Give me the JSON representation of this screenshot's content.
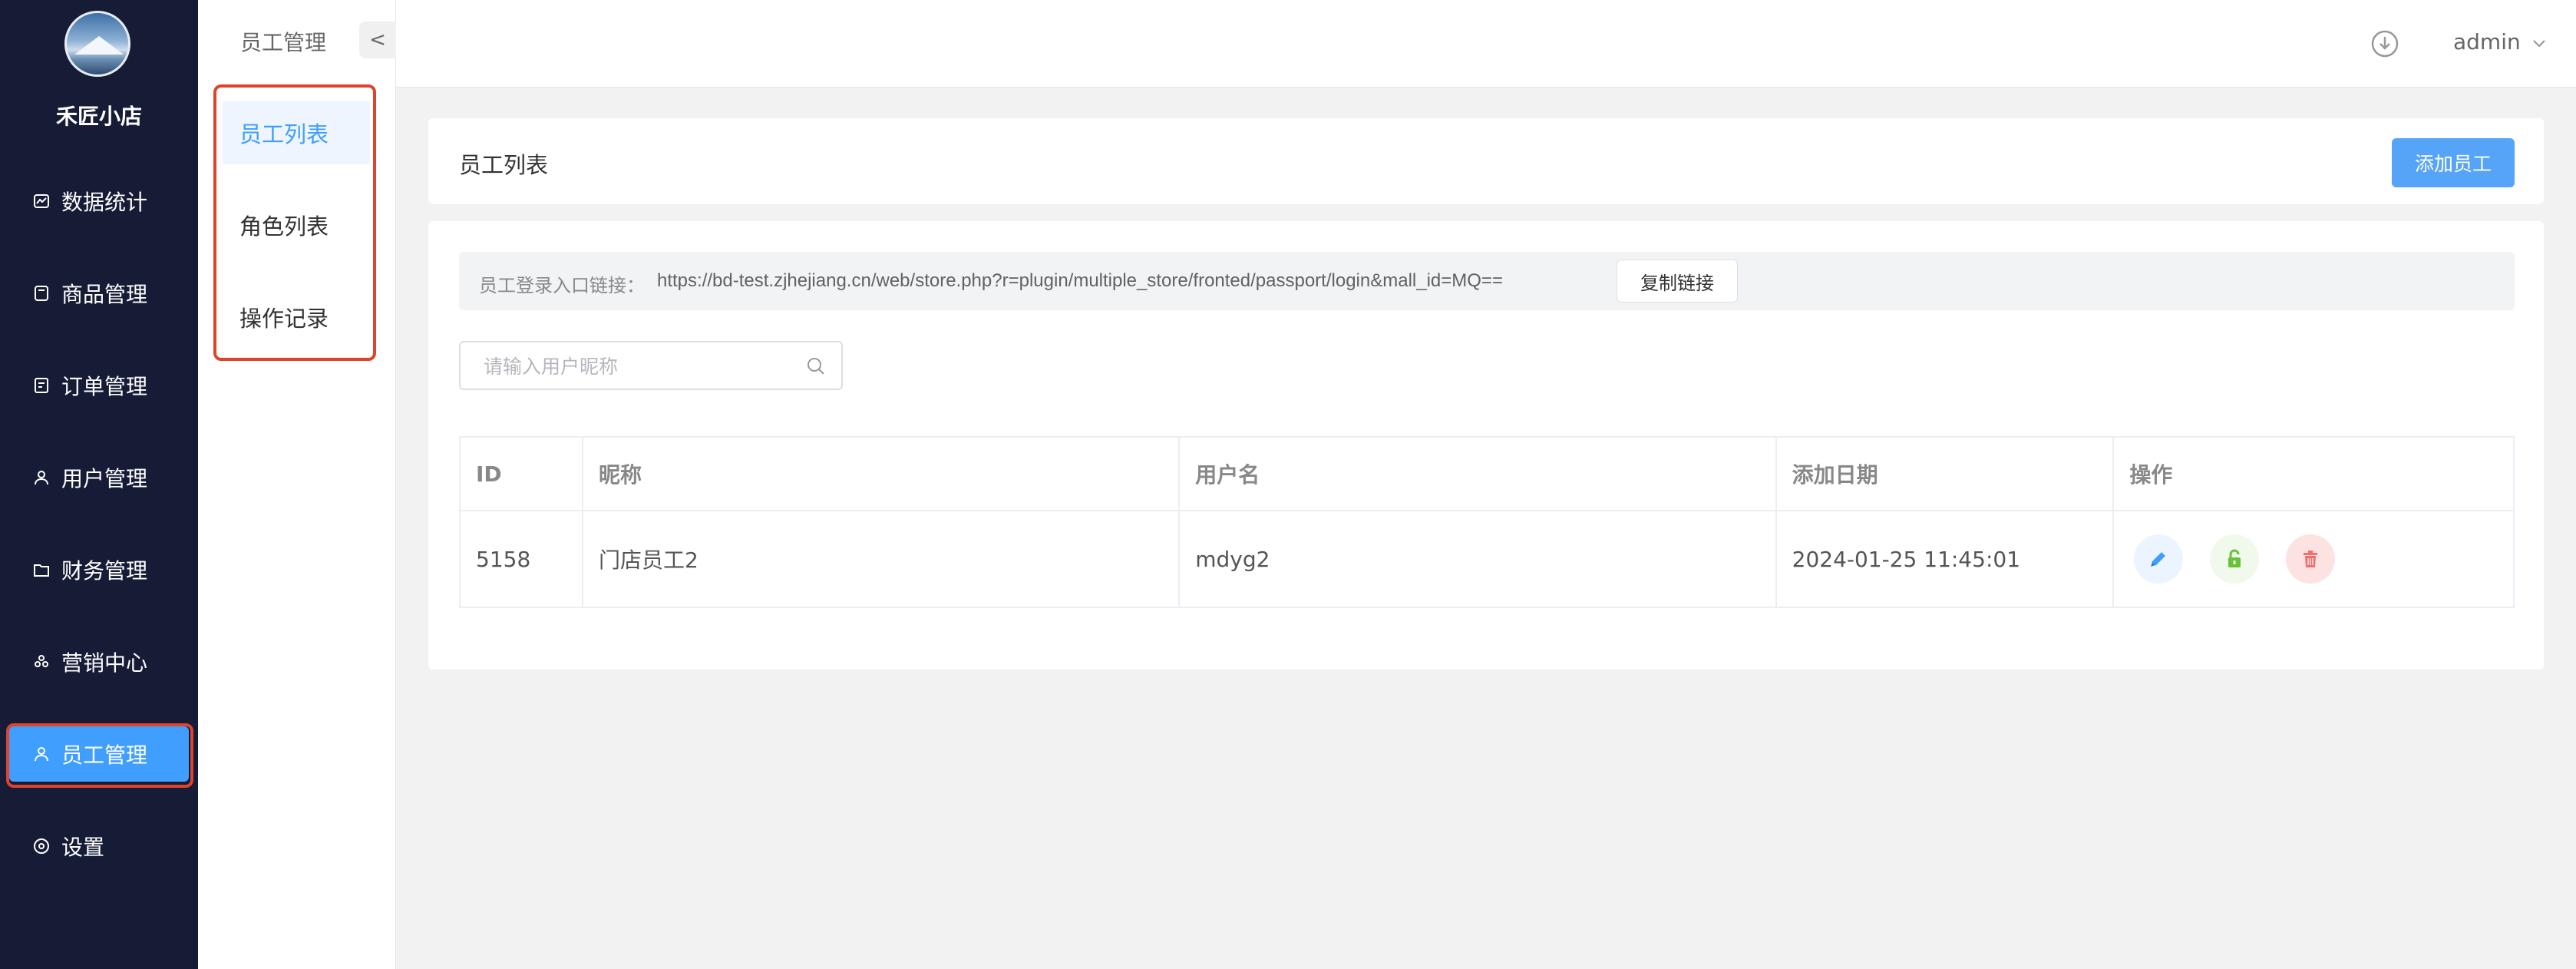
{
  "sidebar": {
    "shop_name": "禾匠小店",
    "items": [
      {
        "label": "数据统计",
        "icon": "chart-icon"
      },
      {
        "label": "商品管理",
        "icon": "goods-icon"
      },
      {
        "label": "订单管理",
        "icon": "order-icon"
      },
      {
        "label": "用户管理",
        "icon": "user-icon"
      },
      {
        "label": "财务管理",
        "icon": "finance-icon"
      },
      {
        "label": "营销中心",
        "icon": "marketing-icon"
      },
      {
        "label": "员工管理",
        "icon": "staff-icon",
        "active": true
      },
      {
        "label": "设置",
        "icon": "settings-icon"
      }
    ]
  },
  "submenu": {
    "title": "员工管理",
    "collapse_label": "<",
    "items": [
      {
        "label": "员工列表",
        "active": true
      },
      {
        "label": "角色列表"
      },
      {
        "label": "操作记录"
      }
    ]
  },
  "header": {
    "user": "admin",
    "download_icon": "download-icon",
    "caret_icon": "chevron-down-icon"
  },
  "page": {
    "title": "员工列表",
    "add_button": "添加员工",
    "link_label": "员工登录入口链接：",
    "link_url": "https://bd-test.zjhejiang.cn/web/store.php?r=plugin/multiple_store/fronted/passport/login&mall_id=MQ==",
    "copy_button": "复制链接",
    "search_placeholder": "请输入用户昵称"
  },
  "table": {
    "headers": {
      "id": "ID",
      "nickname": "昵称",
      "username": "用户名",
      "date": "添加日期",
      "actions": "操作"
    },
    "rows": [
      {
        "id": "5158",
        "nickname": "门店员工2",
        "username": "mdyg2",
        "date": "2024-01-25 11:45:01"
      }
    ]
  },
  "colors": {
    "sidebar_bg": "#161c36",
    "accent": "#409eff",
    "highlight": "#e0432c"
  }
}
